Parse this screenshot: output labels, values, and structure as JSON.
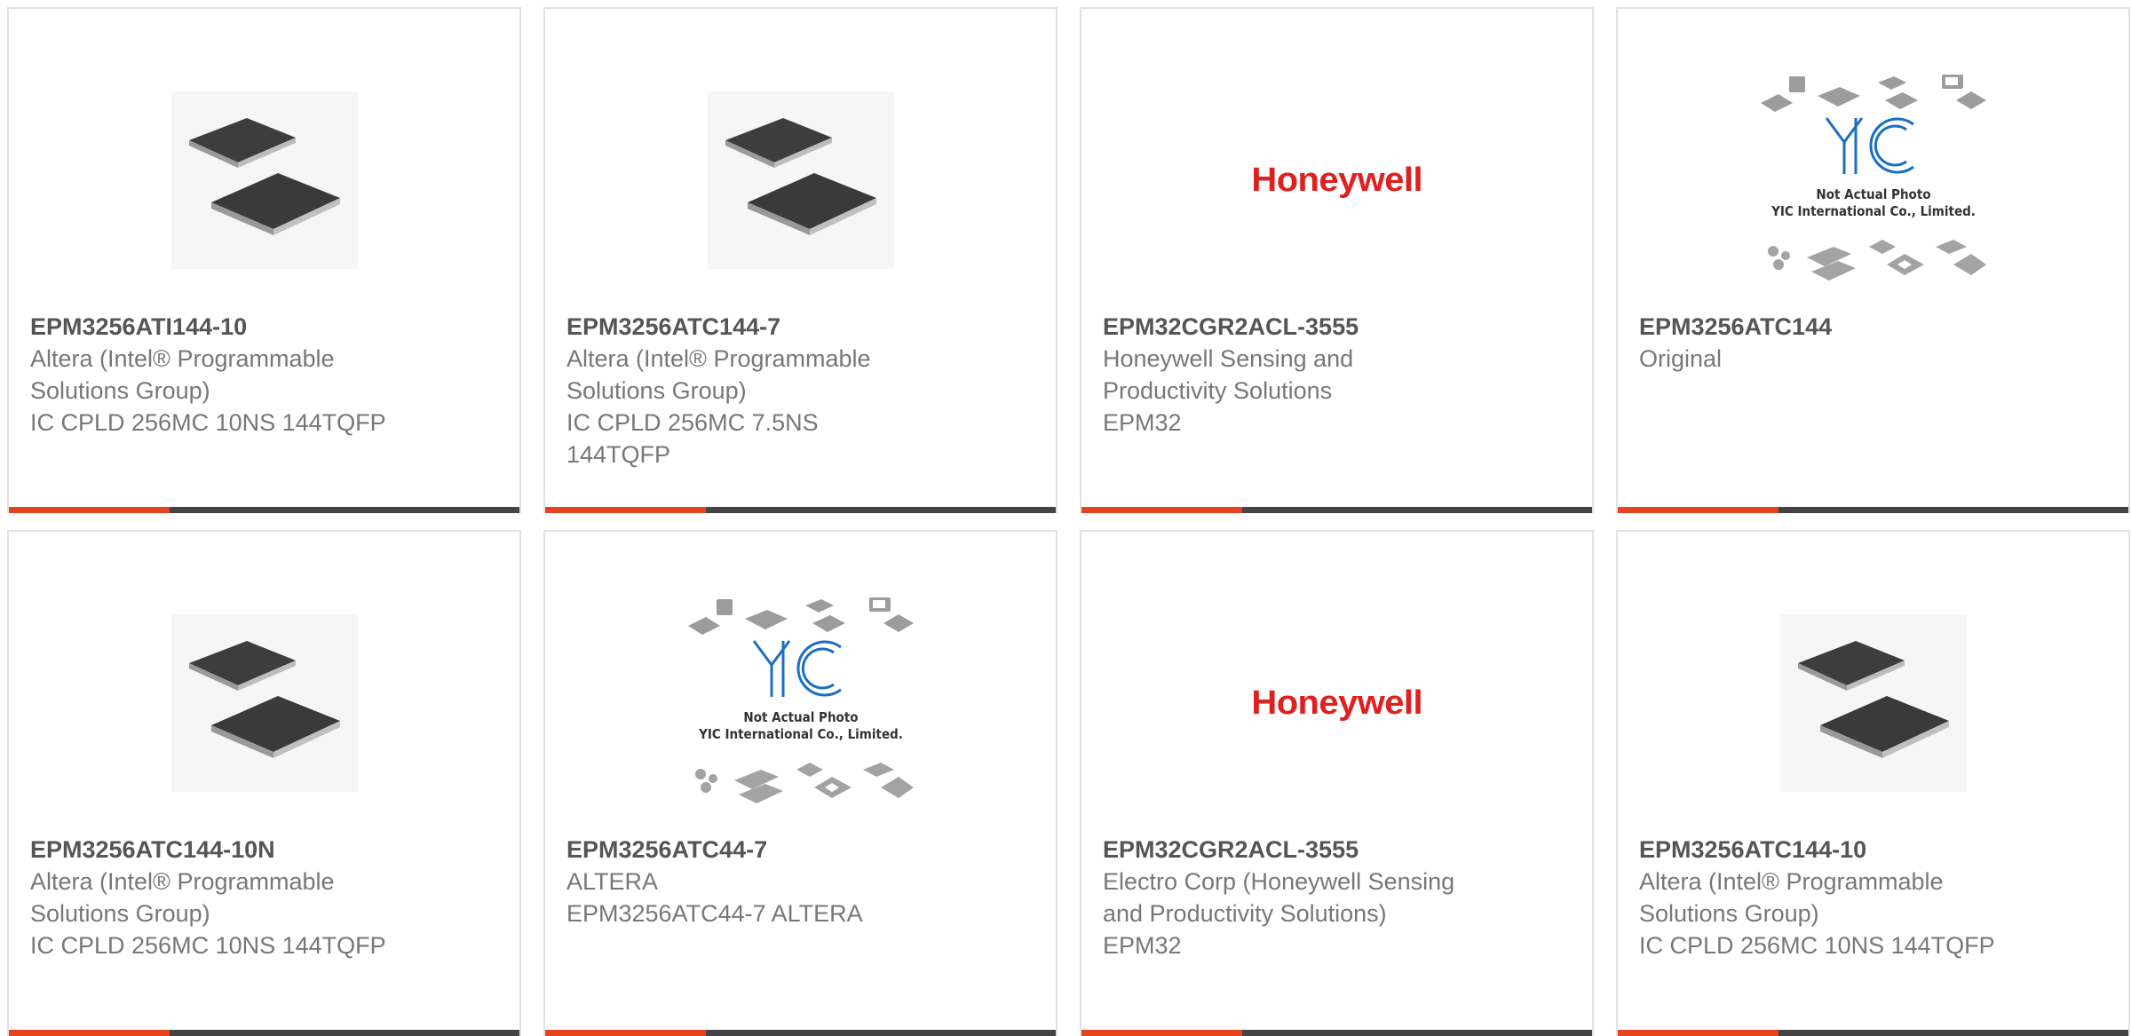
{
  "colors": {
    "accent": "#e8431f",
    "bar": "#444444",
    "honeywell_red": "#e0201f"
  },
  "cards": [
    {
      "image": "chip-photo",
      "part_number": "EPM3256ATI144-10",
      "lines": [
        "Altera (Intel® Programmable",
        "Solutions Group)",
        "IC CPLD 256MC 10NS 144TQFP"
      ]
    },
    {
      "image": "chip-photo",
      "part_number": "EPM3256ATC144-7",
      "lines": [
        "Altera (Intel® Programmable",
        "Solutions Group)",
        "IC CPLD 256MC 7.5NS",
        "144TQFP"
      ]
    },
    {
      "image": "honeywell-logo",
      "logo_text": "Honeywell",
      "part_number": "EPM32CGR2ACL-3555",
      "lines": [
        "Honeywell Sensing and",
        "Productivity Solutions",
        "EPM32"
      ]
    },
    {
      "image": "not-actual-photo",
      "placeholder_line1": "Not Actual Photo",
      "placeholder_line2": "YIC International Co., Limited.",
      "part_number": "EPM3256ATC144",
      "lines": [
        "Original"
      ]
    },
    {
      "image": "chip-photo",
      "part_number": "EPM3256ATC144-10N",
      "lines": [
        "Altera (Intel® Programmable",
        "Solutions Group)",
        "IC CPLD 256MC 10NS 144TQFP"
      ]
    },
    {
      "image": "not-actual-photo",
      "placeholder_line1": "Not Actual Photo",
      "placeholder_line2": "YIC International Co., Limited.",
      "part_number": "EPM3256ATC44-7",
      "lines": [
        "ALTERA",
        "EPM3256ATC44-7 ALTERA"
      ]
    },
    {
      "image": "honeywell-logo",
      "logo_text": "Honeywell",
      "part_number": "EPM32CGR2ACL-3555",
      "lines": [
        "Electro Corp (Honeywell Sensing",
        "and Productivity Solutions)",
        "EPM32"
      ]
    },
    {
      "image": "chip-photo",
      "part_number": "EPM3256ATC144-10",
      "lines": [
        "Altera (Intel® Programmable",
        "Solutions Group)",
        "IC CPLD 256MC 10NS 144TQFP"
      ]
    }
  ]
}
